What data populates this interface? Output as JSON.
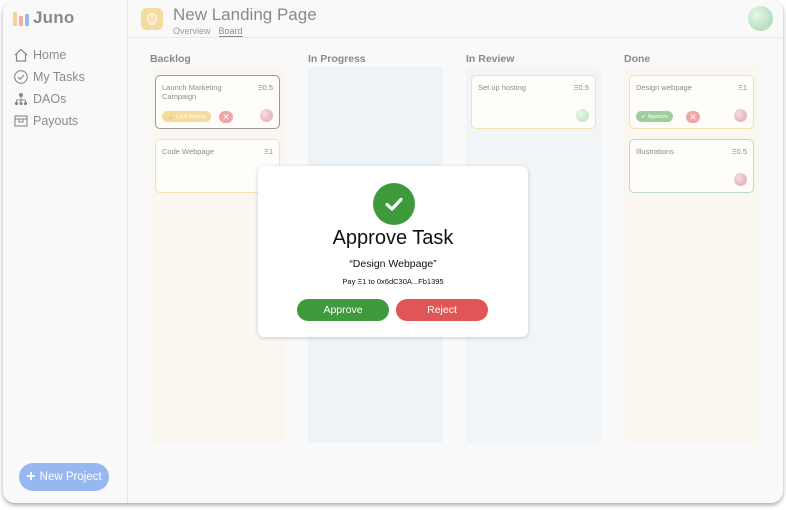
{
  "brand": {
    "name": "Juno",
    "logo_colors": [
      "#f0a030",
      "#e85d4a",
      "#2f6fe0"
    ]
  },
  "sidebar": {
    "items": [
      {
        "label": "Home",
        "icon": "home-icon"
      },
      {
        "label": "My Tasks",
        "icon": "check-circle-icon"
      },
      {
        "label": "DAOs",
        "icon": "org-chart-icon"
      },
      {
        "label": "Payouts",
        "icon": "payout-box-icon"
      }
    ],
    "new_project_label": "New Project"
  },
  "header": {
    "title": "New Landing Page",
    "tabs": [
      {
        "label": "Overview",
        "active": false
      },
      {
        "label": "Board",
        "active": true
      }
    ]
  },
  "board": {
    "columns": [
      {
        "title": "Backlog",
        "bg": "#f5ece0",
        "cards": [
          {
            "title": "Launch Marketing Campaign",
            "value": "Ξ0.5",
            "action": "Lock Bounty",
            "border": "#333333"
          },
          {
            "title": "Code Webpage",
            "value": "Ξ1",
            "border": "#e9c565"
          }
        ]
      },
      {
        "title": "In Progress",
        "bg": "#dde6ef",
        "cards": []
      },
      {
        "title": "In Review",
        "bg": "#e5eaef",
        "cards": [
          {
            "title": "Set up hosting",
            "value": "Ξ0.5",
            "border": "#e9c565"
          }
        ]
      },
      {
        "title": "Done",
        "bg": "#f5ece0",
        "cards": [
          {
            "title": "Design webpage",
            "value": "Ξ1",
            "action": "Approve",
            "border": "#e9c565"
          },
          {
            "title": "Illustrations",
            "value": "Ξ0.5",
            "border": "#79b87a"
          }
        ]
      }
    ]
  },
  "modal": {
    "title": "Approve Task",
    "subtitle": "“Design Webpage”",
    "pay_text": "Pay Ξ1 to 0x6dC30A...Fb1395",
    "approve_label": "Approve",
    "reject_label": "Reject"
  },
  "colors": {
    "accent_blue": "#2f6fe0",
    "approve_green": "#3e9a3a",
    "reject_red": "#e05555",
    "lock_yellow": "#e9b83a"
  }
}
